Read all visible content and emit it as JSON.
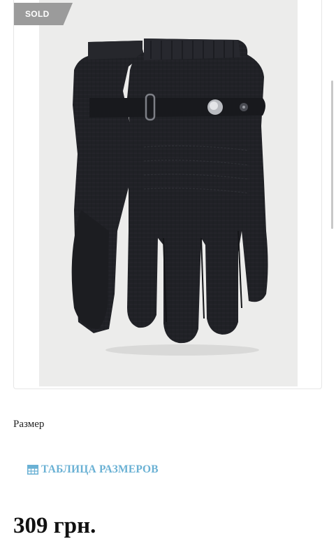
{
  "product": {
    "badge": "SOLD",
    "image_icon": "gloves-photo",
    "size_label": "Размер",
    "size_table_link": "ТАБЛИЦА РАЗМЕРОВ",
    "size_table_icon": "table-icon",
    "price": "309 грн."
  },
  "colors": {
    "badge_bg": "#9b9b9b",
    "link": "#6ab1d4",
    "photo_bg": "#ececeb",
    "glove": "#1f2024"
  }
}
